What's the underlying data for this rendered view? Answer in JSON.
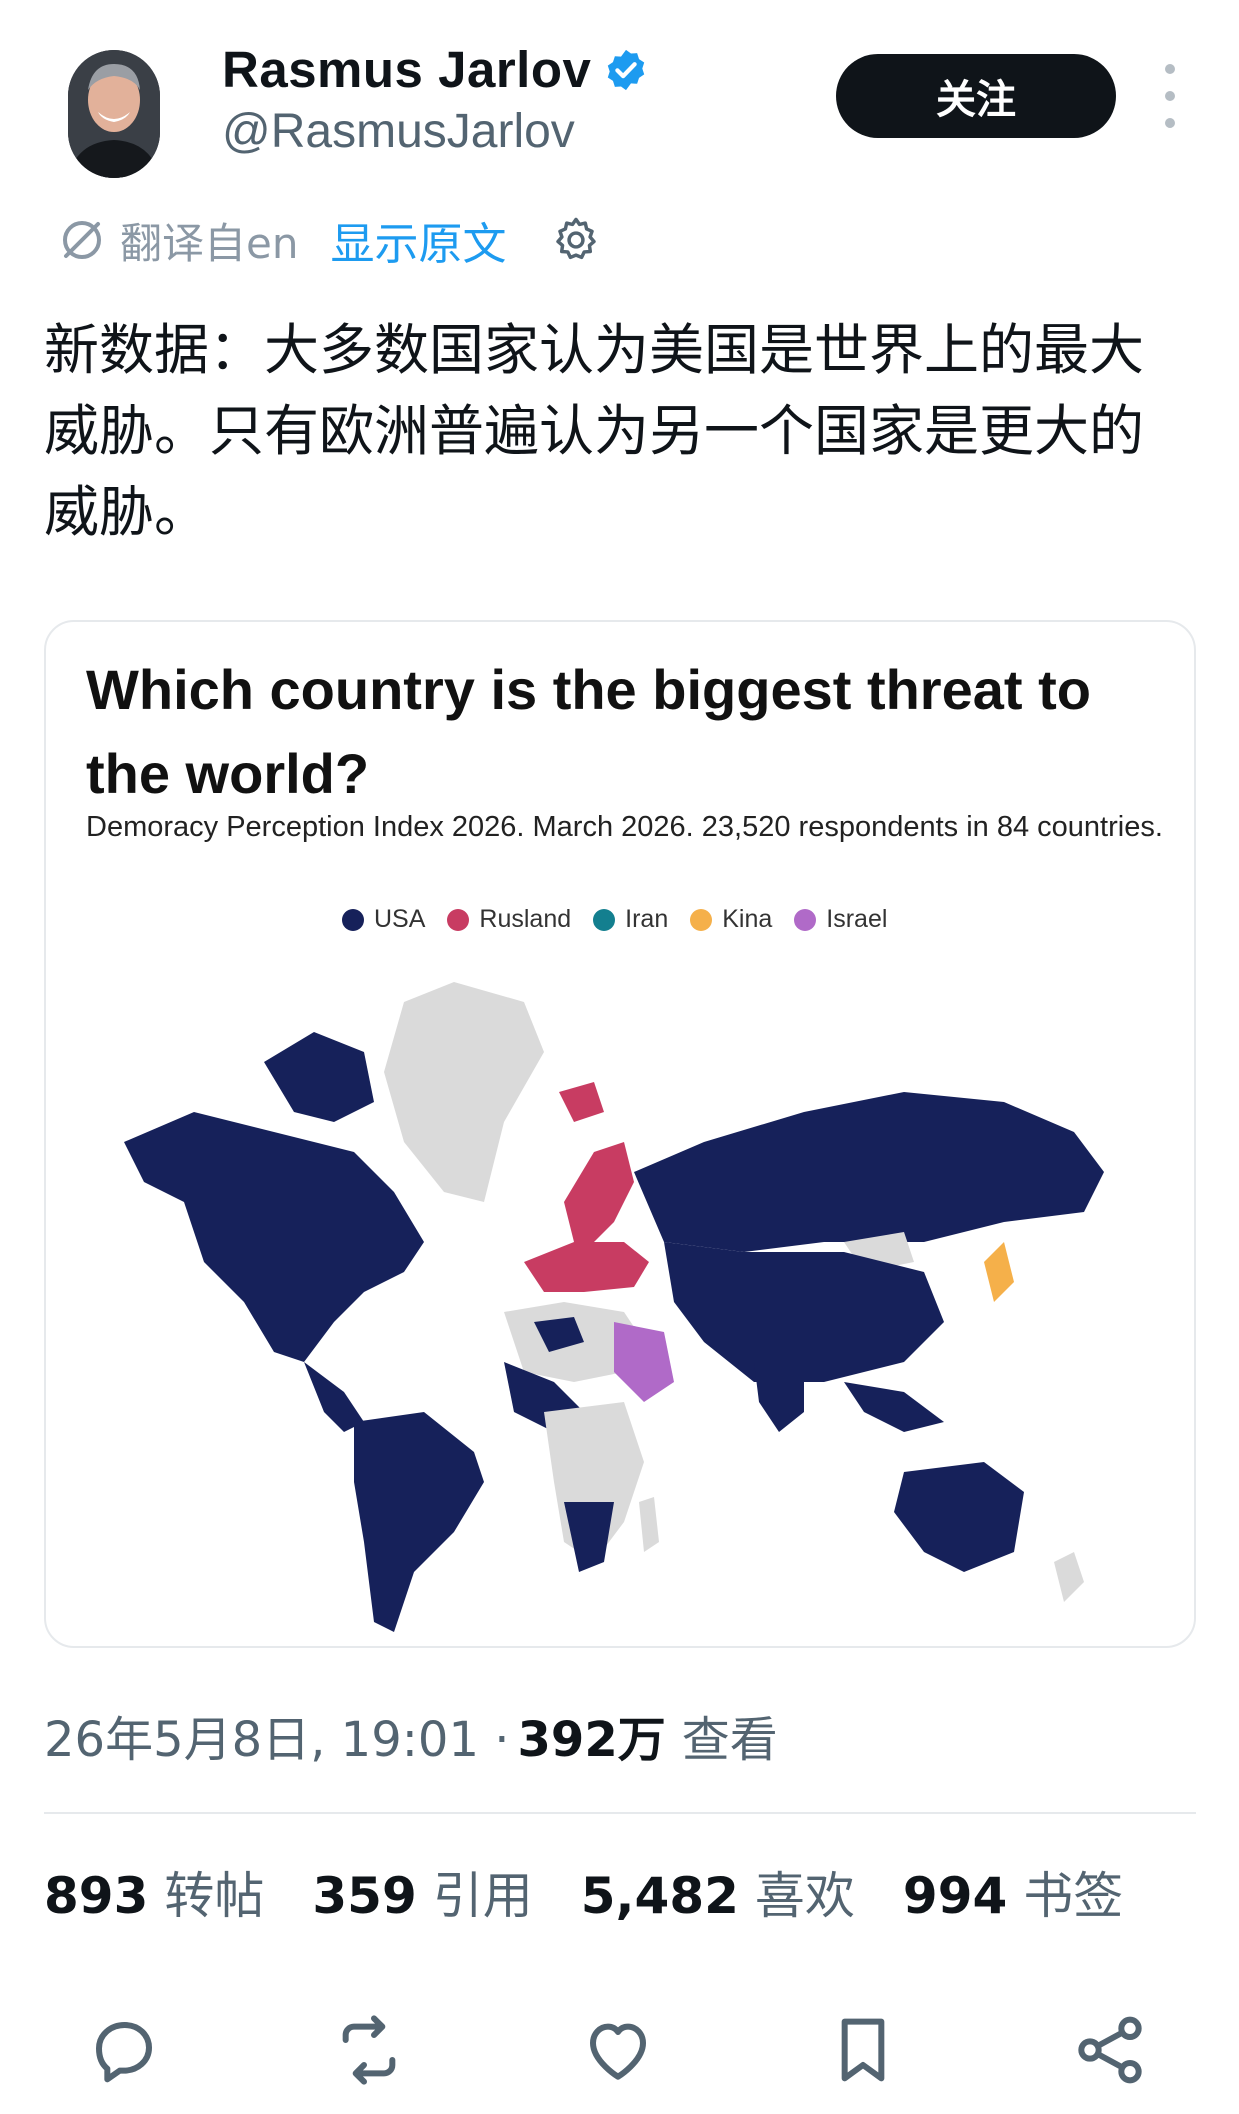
{
  "author": {
    "name": "Rasmus Jarlov",
    "handle": "@RasmusJarlov",
    "follow_label": "关注"
  },
  "translation": {
    "translated_from": "翻译自en",
    "show_original": "显示原文"
  },
  "tweet": {
    "text": "新数据：大多数国家认为美国是世界上的最大威胁。只有欧洲普遍认为另一个国家是更大的威胁。"
  },
  "media": {
    "title": "Which country is the biggest threat to the world?",
    "subtitle": "Demoracy Perception Index 2026. March 2026. 23,520 respondents in 84 countries.",
    "legend": [
      {
        "label": "USA",
        "color": "#16215a"
      },
      {
        "label": "Rusland",
        "color": "#c83c62"
      },
      {
        "label": "Iran",
        "color": "#137f8f"
      },
      {
        "label": "Kina",
        "color": "#f5b04a"
      },
      {
        "label": "Israel",
        "color": "#b06ac8"
      }
    ],
    "no_data_color": "#dadada"
  },
  "meta": {
    "timestamp": "26年5月8日, 19:01 ·",
    "views_count": "392万",
    "views_label": "查看"
  },
  "stats": {
    "reposts_count": "893",
    "reposts_label": "转帖",
    "quotes_count": "359",
    "quotes_label": "引用",
    "likes_count": "5,482",
    "likes_label": "喜欢",
    "bookmarks_count": "994",
    "bookmarks_label": "书签"
  },
  "icons": {
    "reply": "reply-icon",
    "repost": "repost-icon",
    "like": "heart-icon",
    "bookmark": "bookmark-icon",
    "share": "share-icon"
  }
}
